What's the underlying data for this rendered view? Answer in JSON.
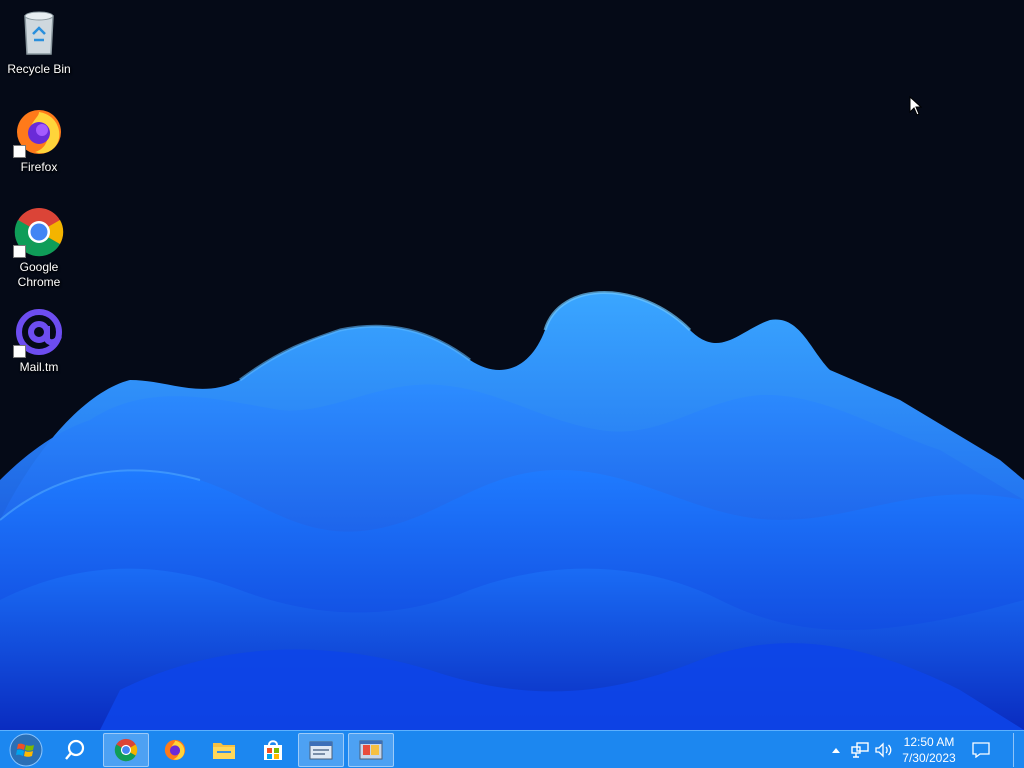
{
  "desktop": {
    "icons": [
      {
        "label": "Recycle Bin",
        "icon": "recycle-bin-icon",
        "shortcut": false
      },
      {
        "label": "Firefox",
        "icon": "firefox-icon",
        "shortcut": true
      },
      {
        "label": "Google Chrome",
        "icon": "chrome-icon",
        "shortcut": true
      },
      {
        "label": "Mail.tm",
        "icon": "mail-at-icon",
        "shortcut": true
      }
    ]
  },
  "taskbar": {
    "start_icon": "windows-logo-icon",
    "items": [
      {
        "name": "search",
        "icon": "search-icon",
        "active": false
      },
      {
        "name": "chrome",
        "icon": "chrome-icon",
        "active": true
      },
      {
        "name": "firefox",
        "icon": "firefox-icon",
        "active": false
      },
      {
        "name": "file-explorer",
        "icon": "folder-icon",
        "active": false
      },
      {
        "name": "store",
        "icon": "store-icon",
        "active": false
      },
      {
        "name": "window-app-1",
        "icon": "window-app-icon",
        "active": true
      },
      {
        "name": "window-app-2",
        "icon": "window-app-icon",
        "active": true
      }
    ],
    "tray": {
      "overflow_icon": "chevron-up-icon",
      "network_icon": "network-icon",
      "volume_icon": "volume-icon",
      "notification_icon": "notification-icon",
      "time": "12:50 AM",
      "date": "7/30/2023"
    }
  },
  "colors": {
    "taskbar": "#1c87f0",
    "desktop_bg": "#050a17",
    "wallpaper_blue": "#1565ff"
  }
}
